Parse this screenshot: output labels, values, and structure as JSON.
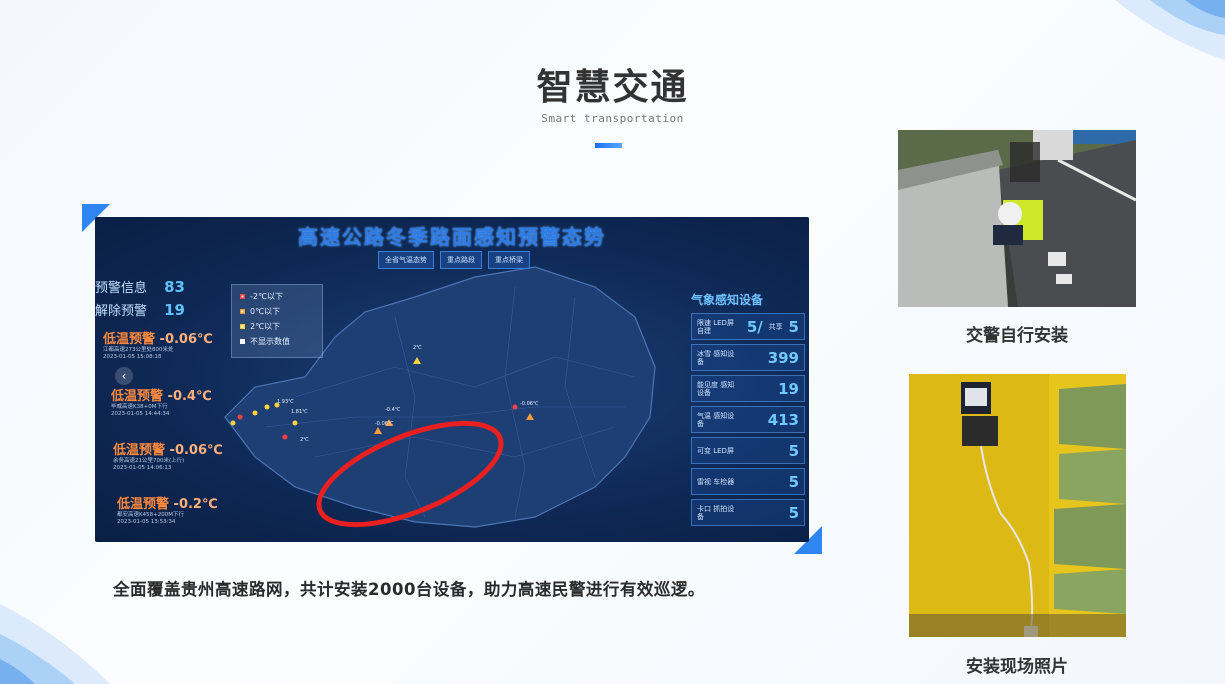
{
  "header": {
    "title": "智慧交通",
    "subtitle": "Smart transportation"
  },
  "dashboard": {
    "title": "高速公路冬季路面感知预警态势",
    "tabs": [
      "全省气温态势",
      "重点路段",
      "重点桥梁"
    ],
    "stats": [
      {
        "label": "预警信息",
        "value": "83"
      },
      {
        "label": "解除预警",
        "value": "19"
      }
    ],
    "alerts": [
      {
        "title": "低温预警",
        "value": "-0.06℃",
        "detail1": "江都高速273公里处800米处",
        "detail2": "2023-01-05 15:08:18"
      },
      {
        "title": "低温预警",
        "value": "-0.4℃",
        "detail1": "毕威高速K38+0M下行",
        "detail2": "2023-01-05 14:44:34"
      },
      {
        "title": "低温预警",
        "value": "-0.06℃",
        "detail1": "余务高速21公里700米(上行)",
        "detail2": "2023-01-05 14:06:13"
      },
      {
        "title": "低温预警",
        "value": "-0.2℃",
        "detail1": "都安高速K458+200M下行",
        "detail2": "2023-01-05 13:53:34"
      }
    ],
    "legend": [
      "-2℃以下",
      "0℃以下",
      "2℃以下",
      "不显示数值"
    ],
    "map_labels": [
      "2℃",
      "-0.06℃",
      "-0.06℃",
      "-0.4℃",
      "1.93℃",
      "1.81℃",
      "2℃"
    ],
    "devices_title": "气象感知设备",
    "devices": [
      {
        "label": "限速 LED屏 自建",
        "value": "5/",
        "extra_label": "共享",
        "extra": "5"
      },
      {
        "label": "冰雪 感知设备",
        "value": "399"
      },
      {
        "label": "能见度 感知设备",
        "value": "19"
      },
      {
        "label": "气温 感知设备",
        "value": "413"
      },
      {
        "label": "可变 LED屏",
        "value": "5"
      },
      {
        "label": "雷视 车检器",
        "value": "5"
      },
      {
        "label": "卡口 抓拍设备",
        "value": "5"
      }
    ],
    "nav_arrow": "‹"
  },
  "caption": "全面覆盖贵州高速路网，共计安装2000台设备，助力高速民警进行有效巡逻。",
  "photos": [
    {
      "label": "交警自行安装"
    },
    {
      "label": "安装现场照片"
    }
  ],
  "colors": {
    "accent": "#1f6df0",
    "alert_orange": "#ff8a3d",
    "dashboard_bg": "#0f2a57",
    "highlight_red": "#e8201f"
  }
}
